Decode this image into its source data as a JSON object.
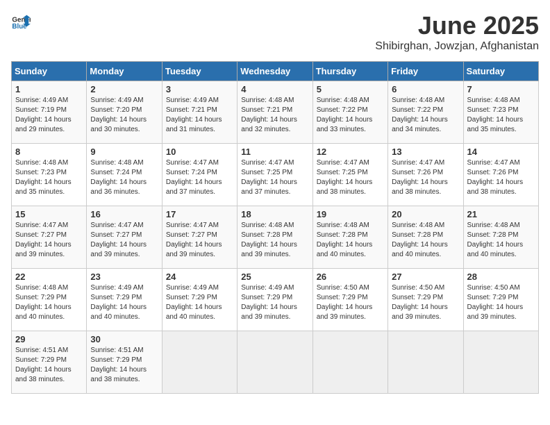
{
  "header": {
    "logo_general": "General",
    "logo_blue": "Blue",
    "month_title": "June 2025",
    "location": "Shibirghan, Jowzjan, Afghanistan"
  },
  "days_of_week": [
    "Sunday",
    "Monday",
    "Tuesday",
    "Wednesday",
    "Thursday",
    "Friday",
    "Saturday"
  ],
  "weeks": [
    [
      {
        "day": "1",
        "info": "Sunrise: 4:49 AM\nSunset: 7:19 PM\nDaylight: 14 hours\nand 29 minutes."
      },
      {
        "day": "2",
        "info": "Sunrise: 4:49 AM\nSunset: 7:20 PM\nDaylight: 14 hours\nand 30 minutes."
      },
      {
        "day": "3",
        "info": "Sunrise: 4:49 AM\nSunset: 7:21 PM\nDaylight: 14 hours\nand 31 minutes."
      },
      {
        "day": "4",
        "info": "Sunrise: 4:48 AM\nSunset: 7:21 PM\nDaylight: 14 hours\nand 32 minutes."
      },
      {
        "day": "5",
        "info": "Sunrise: 4:48 AM\nSunset: 7:22 PM\nDaylight: 14 hours\nand 33 minutes."
      },
      {
        "day": "6",
        "info": "Sunrise: 4:48 AM\nSunset: 7:22 PM\nDaylight: 14 hours\nand 34 minutes."
      },
      {
        "day": "7",
        "info": "Sunrise: 4:48 AM\nSunset: 7:23 PM\nDaylight: 14 hours\nand 35 minutes."
      }
    ],
    [
      {
        "day": "8",
        "info": "Sunrise: 4:48 AM\nSunset: 7:23 PM\nDaylight: 14 hours\nand 35 minutes."
      },
      {
        "day": "9",
        "info": "Sunrise: 4:48 AM\nSunset: 7:24 PM\nDaylight: 14 hours\nand 36 minutes."
      },
      {
        "day": "10",
        "info": "Sunrise: 4:47 AM\nSunset: 7:24 PM\nDaylight: 14 hours\nand 37 minutes."
      },
      {
        "day": "11",
        "info": "Sunrise: 4:47 AM\nSunset: 7:25 PM\nDaylight: 14 hours\nand 37 minutes."
      },
      {
        "day": "12",
        "info": "Sunrise: 4:47 AM\nSunset: 7:25 PM\nDaylight: 14 hours\nand 38 minutes."
      },
      {
        "day": "13",
        "info": "Sunrise: 4:47 AM\nSunset: 7:26 PM\nDaylight: 14 hours\nand 38 minutes."
      },
      {
        "day": "14",
        "info": "Sunrise: 4:47 AM\nSunset: 7:26 PM\nDaylight: 14 hours\nand 38 minutes."
      }
    ],
    [
      {
        "day": "15",
        "info": "Sunrise: 4:47 AM\nSunset: 7:27 PM\nDaylight: 14 hours\nand 39 minutes."
      },
      {
        "day": "16",
        "info": "Sunrise: 4:47 AM\nSunset: 7:27 PM\nDaylight: 14 hours\nand 39 minutes."
      },
      {
        "day": "17",
        "info": "Sunrise: 4:47 AM\nSunset: 7:27 PM\nDaylight: 14 hours\nand 39 minutes."
      },
      {
        "day": "18",
        "info": "Sunrise: 4:48 AM\nSunset: 7:28 PM\nDaylight: 14 hours\nand 39 minutes."
      },
      {
        "day": "19",
        "info": "Sunrise: 4:48 AM\nSunset: 7:28 PM\nDaylight: 14 hours\nand 40 minutes."
      },
      {
        "day": "20",
        "info": "Sunrise: 4:48 AM\nSunset: 7:28 PM\nDaylight: 14 hours\nand 40 minutes."
      },
      {
        "day": "21",
        "info": "Sunrise: 4:48 AM\nSunset: 7:28 PM\nDaylight: 14 hours\nand 40 minutes."
      }
    ],
    [
      {
        "day": "22",
        "info": "Sunrise: 4:48 AM\nSunset: 7:29 PM\nDaylight: 14 hours\nand 40 minutes."
      },
      {
        "day": "23",
        "info": "Sunrise: 4:49 AM\nSunset: 7:29 PM\nDaylight: 14 hours\nand 40 minutes."
      },
      {
        "day": "24",
        "info": "Sunrise: 4:49 AM\nSunset: 7:29 PM\nDaylight: 14 hours\nand 40 minutes."
      },
      {
        "day": "25",
        "info": "Sunrise: 4:49 AM\nSunset: 7:29 PM\nDaylight: 14 hours\nand 39 minutes."
      },
      {
        "day": "26",
        "info": "Sunrise: 4:50 AM\nSunset: 7:29 PM\nDaylight: 14 hours\nand 39 minutes."
      },
      {
        "day": "27",
        "info": "Sunrise: 4:50 AM\nSunset: 7:29 PM\nDaylight: 14 hours\nand 39 minutes."
      },
      {
        "day": "28",
        "info": "Sunrise: 4:50 AM\nSunset: 7:29 PM\nDaylight: 14 hours\nand 39 minutes."
      }
    ],
    [
      {
        "day": "29",
        "info": "Sunrise: 4:51 AM\nSunset: 7:29 PM\nDaylight: 14 hours\nand 38 minutes."
      },
      {
        "day": "30",
        "info": "Sunrise: 4:51 AM\nSunset: 7:29 PM\nDaylight: 14 hours\nand 38 minutes."
      },
      {
        "day": "",
        "info": ""
      },
      {
        "day": "",
        "info": ""
      },
      {
        "day": "",
        "info": ""
      },
      {
        "day": "",
        "info": ""
      },
      {
        "day": "",
        "info": ""
      }
    ]
  ]
}
